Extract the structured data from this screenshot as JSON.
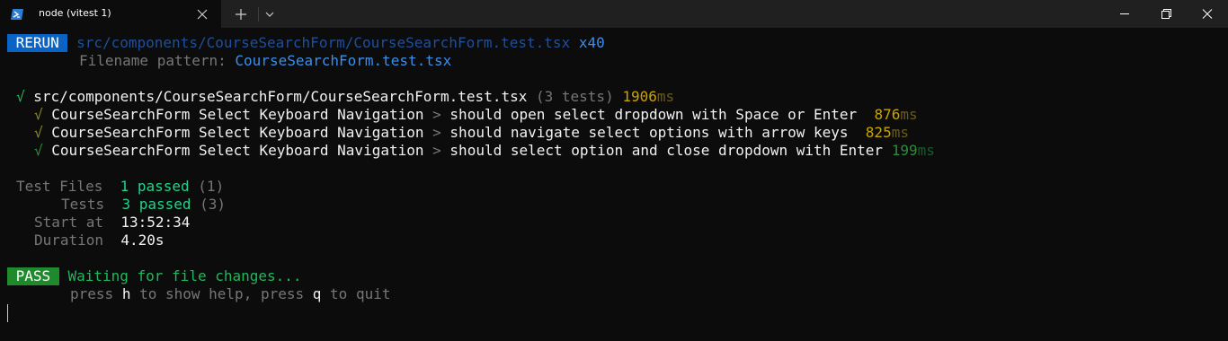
{
  "window": {
    "tab_title": "node (vitest 1)"
  },
  "terminal": {
    "rerun": {
      "badge": "RERUN",
      "path": "src/components/CourseSearchForm/CourseSearchForm.test.tsx",
      "count": "x40",
      "filter_label": "Filename pattern:",
      "filter_value": "CourseSearchForm.test.tsx"
    },
    "suite": {
      "check": "√",
      "path": "src/components/CourseSearchForm/CourseSearchForm.test.tsx",
      "count": "(3 tests)",
      "time": "1906",
      "unit": "ms"
    },
    "tests": [
      {
        "check": "√",
        "prefix": "CourseSearchForm Select Keyboard Navigation",
        "sep": ">",
        "name": "should open select dropdown with Space or Enter",
        "time": "876",
        "unit": "ms"
      },
      {
        "check": "√",
        "prefix": "CourseSearchForm Select Keyboard Navigation",
        "sep": ">",
        "name": "should navigate select options with arrow keys",
        "time": "825",
        "unit": "ms"
      },
      {
        "check": "√",
        "prefix": "CourseSearchForm Select Keyboard Navigation",
        "sep": ">",
        "name": "should select option and close dropdown with Enter",
        "time": "199",
        "unit": "ms"
      }
    ],
    "summary": {
      "files_label": "Test Files",
      "files_value": "1 passed",
      "files_total": "(1)",
      "tests_label": "Tests",
      "tests_value": "3 passed",
      "tests_total": "(3)",
      "start_label": "Start at",
      "start_value": "13:52:34",
      "duration_label": "Duration",
      "duration_value": "4.20s"
    },
    "watch": {
      "badge": "PASS",
      "waiting": "Waiting for file changes...",
      "help_pre": "press",
      "help_key": "h",
      "help_mid": "to show help, press",
      "quit_key": "q",
      "help_post": "to quit"
    }
  },
  "colors": {
    "background": "#0c0c0c",
    "titlebar": "#202020",
    "rerun_badge": "#0b63c4",
    "pass_badge": "#1f8a2c",
    "pass_text": "#1fb85c",
    "slow_time": "#c9a300"
  },
  "icons": [
    "powershell-icon",
    "close-icon",
    "plus-icon",
    "chevron-down-icon",
    "minimize-icon",
    "maximize-icon",
    "window-close-icon"
  ]
}
